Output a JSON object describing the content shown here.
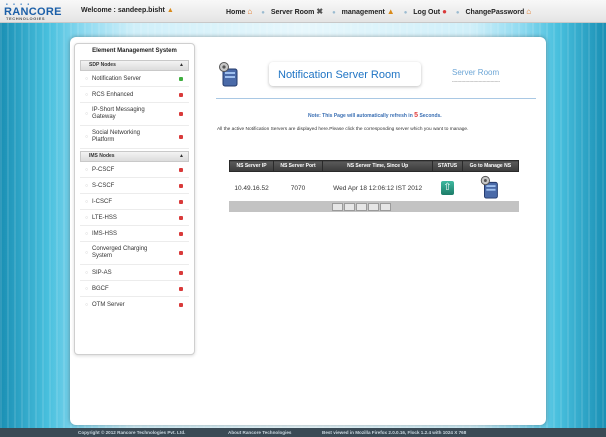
{
  "header": {
    "logo_brand": "RANCORE",
    "logo_sub": "TECHNOLOGIES",
    "welcome": "Welcome : sandeep.bisht",
    "nav": [
      {
        "label": "Home",
        "icon": "home-icon"
      },
      {
        "label": "Server Room",
        "icon": "tools-icon"
      },
      {
        "label": "management",
        "icon": "user-icon"
      },
      {
        "label": "Log Out",
        "icon": "logout-icon"
      },
      {
        "label": "ChangePassword",
        "icon": "password-icon"
      }
    ]
  },
  "sidebar": {
    "title": "Element Management System",
    "sections": [
      {
        "label": "SDP Nodes",
        "items": [
          {
            "label": "Notification Server",
            "status": "green"
          },
          {
            "label": "RCS Enhanced",
            "status": "red"
          },
          {
            "label": "IP-Short Messaging Gateway",
            "status": "red"
          },
          {
            "label": "Social Networking Platform",
            "status": "red"
          }
        ]
      },
      {
        "label": "IMS Nodes",
        "items": [
          {
            "label": "P-CSCF",
            "status": "red"
          },
          {
            "label": "S-CSCF",
            "status": "red"
          },
          {
            "label": "I-CSCF",
            "status": "red"
          },
          {
            "label": "LTE-HSS",
            "status": "red"
          },
          {
            "label": "IMS-HSS",
            "status": "red"
          },
          {
            "label": "Converged Charging System",
            "status": "red"
          },
          {
            "label": "SIP-AS",
            "status": "red"
          },
          {
            "label": "BGCF",
            "status": "red"
          },
          {
            "label": "OTM Server",
            "status": "red"
          }
        ]
      }
    ]
  },
  "main": {
    "title": "Notification Server Room",
    "crumb": "Server Room",
    "crumb_dashes": "------------------------------------",
    "note_prefix": "Note: This Page will automatically refresh in",
    "note_num": "5",
    "note_suffix": "Seconds.",
    "description": "All the active Notification Servers are displayed here.Please click the corresponding server which you want to manage.",
    "table": {
      "headers": [
        "NS Server IP",
        "NS Server Port",
        "NS Server Time, Since Up",
        "STATUS",
        "Go to Manage NS"
      ],
      "rows": [
        {
          "ip": "10.49.16.52",
          "port": "7070",
          "time": "Wed Apr 18 12:06:12 IST 2012"
        }
      ]
    }
  },
  "footer": {
    "copyright": "Copyright © 2012 Rancore Technologies Pvt. Ltd.",
    "about": "About Rancore Technologies",
    "best_viewed": "Best viewed in Mozilla Firefox 2.0.0.16, Flock 1.2.4 with 1024 X 768"
  },
  "colors": {
    "led_green": "#3fae3f",
    "led_red": "#d93a3a",
    "title_blue": "#1f74c4"
  }
}
